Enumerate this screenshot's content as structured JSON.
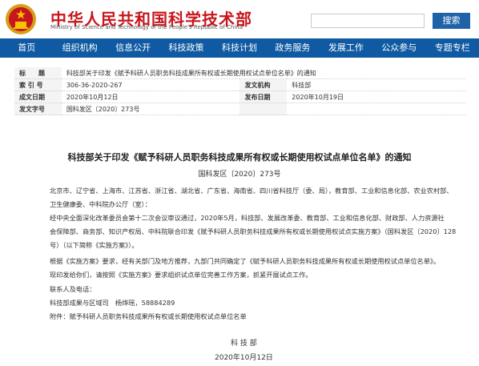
{
  "header": {
    "title": "中华人民共和国科学技术部",
    "subtitle": "Ministry of Science and Technology of the People's Republic of China",
    "search_placeholder": "",
    "search_button": "搜索"
  },
  "nav": [
    "首页",
    "组织机构",
    "信息公开",
    "科技政策",
    "科技计划",
    "政务服务",
    "发展工作",
    "公众参与",
    "专题专栏"
  ],
  "meta": {
    "rows": [
      [
        {
          "label": "标　　题",
          "value": "科技部关于印发《赋予科研人员职务科技成果所有权或长期使用权试点单位名单》的通知"
        }
      ],
      [
        {
          "label": "索 引 号",
          "value": "306-36-2020-267"
        },
        {
          "label": "发文机构",
          "value": "科技部"
        }
      ],
      [
        {
          "label": "成文日期",
          "value": "2020年10月12日"
        },
        {
          "label": "发布日期",
          "value": "2020年10月19日"
        }
      ],
      [
        {
          "label": "发文字号",
          "value": "国科发区〔2020〕273号"
        },
        {
          "label": "",
          "value": ""
        }
      ]
    ]
  },
  "document": {
    "title": "科技部关于印发《赋予科研人员职务科技成果所有权或长期使用权试点单位名单》的通知",
    "number": "国科发区〔2020〕273号",
    "lines": [
      "北京市、辽宁省、上海市、江苏省、浙江省、湖北省、广东省、海南省、四川省科技厅（委、局），教育部、工业和信息化部、农业农村部、",
      "卫生健康委、中科院办公厅（室）：",
      "经中央全面深化改革委员会第十二次会议审议通过，2020年5月，科技部、发展改革委、教育部、工业和信息化部、财政部、人力资源社",
      "会保障部、商务部、知识产权局、中科院联合印发《赋予科研人员职务科技成果所有权或长期使用权试点实施方案》（国科发区〔2020〕128",
      "号）（以下简称《实施方案》）。",
      "根据《实施方案》要求，经有关部门及地方推荐，九部门共同确定了《赋予科研人员职务科技成果所有权或长期使用权试点单位名单》。",
      "现印发给你们，请按照《实施方案》要求组织试点单位完善工作方案，抓紧开展试点工作。",
      "联系人及电话：",
      "科技部成果与区域司　杨烨瑶，58884289",
      "附件：赋予科研人员职务科技成果所有权或长期使用权试点单位名单"
    ],
    "signature": "科 技 部",
    "date": "2020年10月12日"
  }
}
